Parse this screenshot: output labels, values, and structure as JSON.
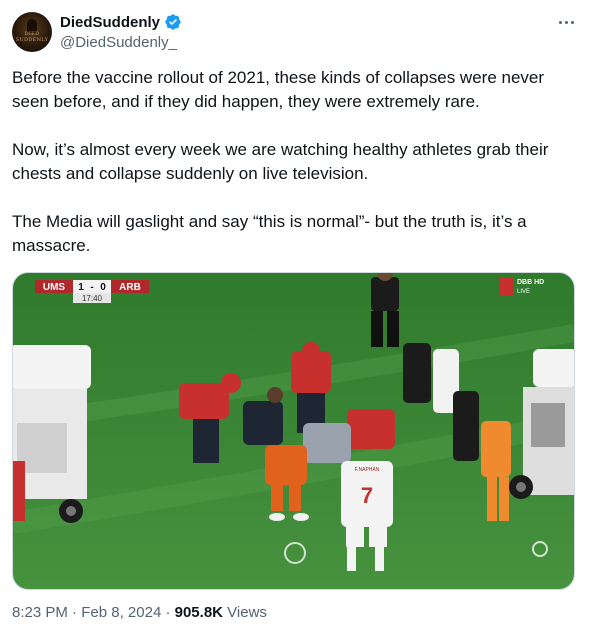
{
  "author": {
    "display_name": "DiedSuddenly",
    "handle": "@DiedSuddenly_",
    "avatar_text": "DIED SUDDENLY",
    "verified_color": "#1d9bf0"
  },
  "tweet": {
    "paragraphs": [
      "Before the vaccine rollout of 2021, these kinds of collapses were never seen before, and if they did happen, they were extremely rare.",
      "Now, it’s almost every week we are watching healthy athletes grab their chests and collapse suddenly on live television.",
      "The Media will gaslight and say “this is normal”- but the truth is, it’s a massacre."
    ]
  },
  "media": {
    "scoreboard": {
      "home": "UMS",
      "home_score": "1",
      "separator": "-",
      "away_score": "0",
      "away": "ARB",
      "clock": "17:40"
    },
    "broadcaster": {
      "logo": "DBB HD",
      "live": "LIVE"
    },
    "player_shirt": {
      "name": "F.NAPHAN",
      "number": "7"
    }
  },
  "meta": {
    "time": "8:23 PM",
    "date": "Feb 8, 2024",
    "views_count": "905.8K",
    "views_label": "Views"
  },
  "colors": {
    "text": "#0f1419",
    "secondary": "#536471",
    "pitch": "#3f8a3a",
    "medic_red": "#c8302e"
  }
}
